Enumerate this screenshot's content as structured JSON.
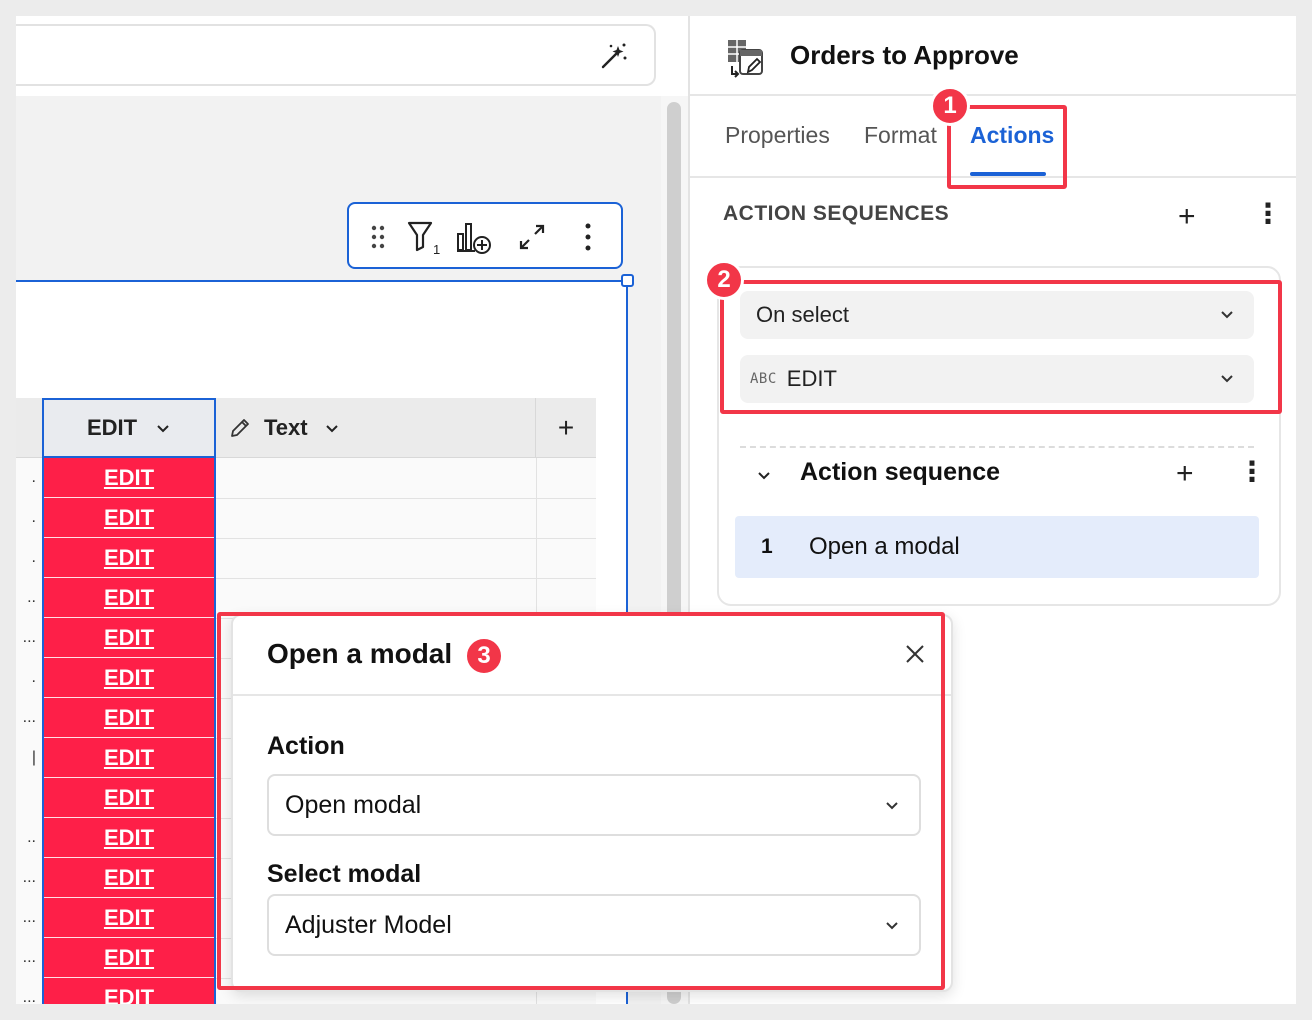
{
  "panel": {
    "title": "Orders to Approve",
    "tabs": [
      {
        "label": "Properties"
      },
      {
        "label": "Format"
      },
      {
        "label": "Actions"
      }
    ],
    "section_title": "ACTION SEQUENCES",
    "trigger": "On select",
    "column_type": "ABC",
    "column": "EDIT",
    "sequence_title": "Action sequence",
    "steps": [
      {
        "num": "1",
        "label": "Open a modal"
      }
    ]
  },
  "table": {
    "headers": {
      "edit": "EDIT",
      "text": "Text",
      "add": "+"
    },
    "edit_cell": "EDIT",
    "row_count": 14
  },
  "modal": {
    "title": "Open a modal",
    "action_label": "Action",
    "action_value": "Open modal",
    "select_label": "Select modal",
    "select_value": "Adjuster Model"
  },
  "callouts": [
    "1",
    "2",
    "3"
  ],
  "colors": {
    "accent": "#1b62d6",
    "callout": "#f23648",
    "edit_fill": "#fe1f48"
  }
}
